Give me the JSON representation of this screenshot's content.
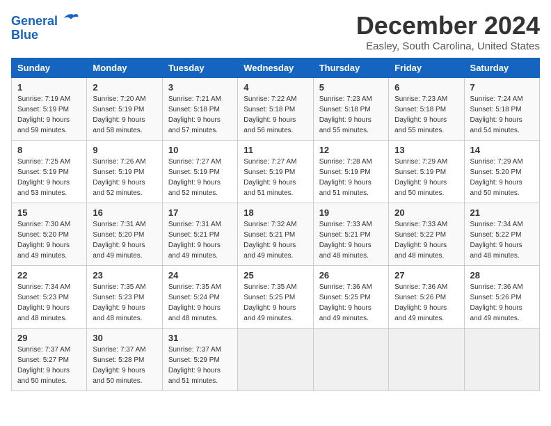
{
  "logo": {
    "line1": "General",
    "line2": "Blue"
  },
  "title": "December 2024",
  "subtitle": "Easley, South Carolina, United States",
  "weekdays": [
    "Sunday",
    "Monday",
    "Tuesday",
    "Wednesday",
    "Thursday",
    "Friday",
    "Saturday"
  ],
  "weeks": [
    [
      {
        "day": "1",
        "sunrise": "Sunrise: 7:19 AM",
        "sunset": "Sunset: 5:19 PM",
        "daylight": "Daylight: 9 hours and 59 minutes."
      },
      {
        "day": "2",
        "sunrise": "Sunrise: 7:20 AM",
        "sunset": "Sunset: 5:19 PM",
        "daylight": "Daylight: 9 hours and 58 minutes."
      },
      {
        "day": "3",
        "sunrise": "Sunrise: 7:21 AM",
        "sunset": "Sunset: 5:18 PM",
        "daylight": "Daylight: 9 hours and 57 minutes."
      },
      {
        "day": "4",
        "sunrise": "Sunrise: 7:22 AM",
        "sunset": "Sunset: 5:18 PM",
        "daylight": "Daylight: 9 hours and 56 minutes."
      },
      {
        "day": "5",
        "sunrise": "Sunrise: 7:23 AM",
        "sunset": "Sunset: 5:18 PM",
        "daylight": "Daylight: 9 hours and 55 minutes."
      },
      {
        "day": "6",
        "sunrise": "Sunrise: 7:23 AM",
        "sunset": "Sunset: 5:18 PM",
        "daylight": "Daylight: 9 hours and 55 minutes."
      },
      {
        "day": "7",
        "sunrise": "Sunrise: 7:24 AM",
        "sunset": "Sunset: 5:18 PM",
        "daylight": "Daylight: 9 hours and 54 minutes."
      }
    ],
    [
      {
        "day": "8",
        "sunrise": "Sunrise: 7:25 AM",
        "sunset": "Sunset: 5:19 PM",
        "daylight": "Daylight: 9 hours and 53 minutes."
      },
      {
        "day": "9",
        "sunrise": "Sunrise: 7:26 AM",
        "sunset": "Sunset: 5:19 PM",
        "daylight": "Daylight: 9 hours and 52 minutes."
      },
      {
        "day": "10",
        "sunrise": "Sunrise: 7:27 AM",
        "sunset": "Sunset: 5:19 PM",
        "daylight": "Daylight: 9 hours and 52 minutes."
      },
      {
        "day": "11",
        "sunrise": "Sunrise: 7:27 AM",
        "sunset": "Sunset: 5:19 PM",
        "daylight": "Daylight: 9 hours and 51 minutes."
      },
      {
        "day": "12",
        "sunrise": "Sunrise: 7:28 AM",
        "sunset": "Sunset: 5:19 PM",
        "daylight": "Daylight: 9 hours and 51 minutes."
      },
      {
        "day": "13",
        "sunrise": "Sunrise: 7:29 AM",
        "sunset": "Sunset: 5:19 PM",
        "daylight": "Daylight: 9 hours and 50 minutes."
      },
      {
        "day": "14",
        "sunrise": "Sunrise: 7:29 AM",
        "sunset": "Sunset: 5:20 PM",
        "daylight": "Daylight: 9 hours and 50 minutes."
      }
    ],
    [
      {
        "day": "15",
        "sunrise": "Sunrise: 7:30 AM",
        "sunset": "Sunset: 5:20 PM",
        "daylight": "Daylight: 9 hours and 49 minutes."
      },
      {
        "day": "16",
        "sunrise": "Sunrise: 7:31 AM",
        "sunset": "Sunset: 5:20 PM",
        "daylight": "Daylight: 9 hours and 49 minutes."
      },
      {
        "day": "17",
        "sunrise": "Sunrise: 7:31 AM",
        "sunset": "Sunset: 5:21 PM",
        "daylight": "Daylight: 9 hours and 49 minutes."
      },
      {
        "day": "18",
        "sunrise": "Sunrise: 7:32 AM",
        "sunset": "Sunset: 5:21 PM",
        "daylight": "Daylight: 9 hours and 49 minutes."
      },
      {
        "day": "19",
        "sunrise": "Sunrise: 7:33 AM",
        "sunset": "Sunset: 5:21 PM",
        "daylight": "Daylight: 9 hours and 48 minutes."
      },
      {
        "day": "20",
        "sunrise": "Sunrise: 7:33 AM",
        "sunset": "Sunset: 5:22 PM",
        "daylight": "Daylight: 9 hours and 48 minutes."
      },
      {
        "day": "21",
        "sunrise": "Sunrise: 7:34 AM",
        "sunset": "Sunset: 5:22 PM",
        "daylight": "Daylight: 9 hours and 48 minutes."
      }
    ],
    [
      {
        "day": "22",
        "sunrise": "Sunrise: 7:34 AM",
        "sunset": "Sunset: 5:23 PM",
        "daylight": "Daylight: 9 hours and 48 minutes."
      },
      {
        "day": "23",
        "sunrise": "Sunrise: 7:35 AM",
        "sunset": "Sunset: 5:23 PM",
        "daylight": "Daylight: 9 hours and 48 minutes."
      },
      {
        "day": "24",
        "sunrise": "Sunrise: 7:35 AM",
        "sunset": "Sunset: 5:24 PM",
        "daylight": "Daylight: 9 hours and 48 minutes."
      },
      {
        "day": "25",
        "sunrise": "Sunrise: 7:35 AM",
        "sunset": "Sunset: 5:25 PM",
        "daylight": "Daylight: 9 hours and 49 minutes."
      },
      {
        "day": "26",
        "sunrise": "Sunrise: 7:36 AM",
        "sunset": "Sunset: 5:25 PM",
        "daylight": "Daylight: 9 hours and 49 minutes."
      },
      {
        "day": "27",
        "sunrise": "Sunrise: 7:36 AM",
        "sunset": "Sunset: 5:26 PM",
        "daylight": "Daylight: 9 hours and 49 minutes."
      },
      {
        "day": "28",
        "sunrise": "Sunrise: 7:36 AM",
        "sunset": "Sunset: 5:26 PM",
        "daylight": "Daylight: 9 hours and 49 minutes."
      }
    ],
    [
      {
        "day": "29",
        "sunrise": "Sunrise: 7:37 AM",
        "sunset": "Sunset: 5:27 PM",
        "daylight": "Daylight: 9 hours and 50 minutes."
      },
      {
        "day": "30",
        "sunrise": "Sunrise: 7:37 AM",
        "sunset": "Sunset: 5:28 PM",
        "daylight": "Daylight: 9 hours and 50 minutes."
      },
      {
        "day": "31",
        "sunrise": "Sunrise: 7:37 AM",
        "sunset": "Sunset: 5:29 PM",
        "daylight": "Daylight: 9 hours and 51 minutes."
      },
      null,
      null,
      null,
      null
    ]
  ]
}
